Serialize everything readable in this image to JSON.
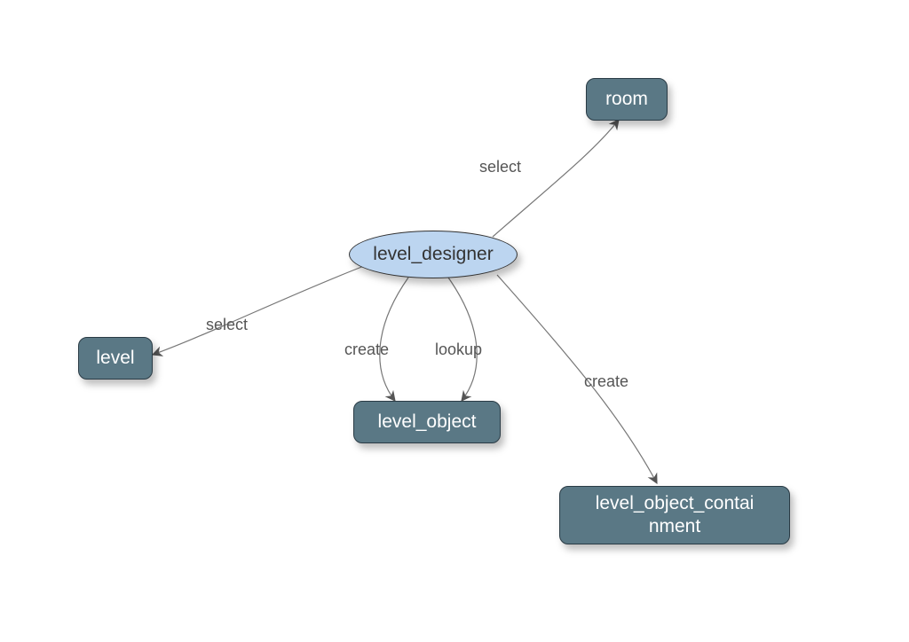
{
  "diagram": {
    "center_node": {
      "label": "level_designer"
    },
    "targets": {
      "room": {
        "label": "room"
      },
      "level": {
        "label": "level"
      },
      "level_object": {
        "label": "level_object"
      },
      "level_object_containment": {
        "label": "level_object_contai\nnment"
      }
    },
    "edges": {
      "to_room": {
        "label": "select"
      },
      "to_level": {
        "label": "select"
      },
      "to_level_object_create": {
        "label": "create"
      },
      "to_level_object_lookup": {
        "label": "lookup"
      },
      "to_level_object_containment": {
        "label": "create"
      }
    }
  },
  "colors": {
    "ellipse_fill": "#bcd5f0",
    "rect_fill": "#5a7885",
    "rect_text": "#ffffff",
    "edge_stroke": "#777777",
    "label_color": "#555555"
  }
}
